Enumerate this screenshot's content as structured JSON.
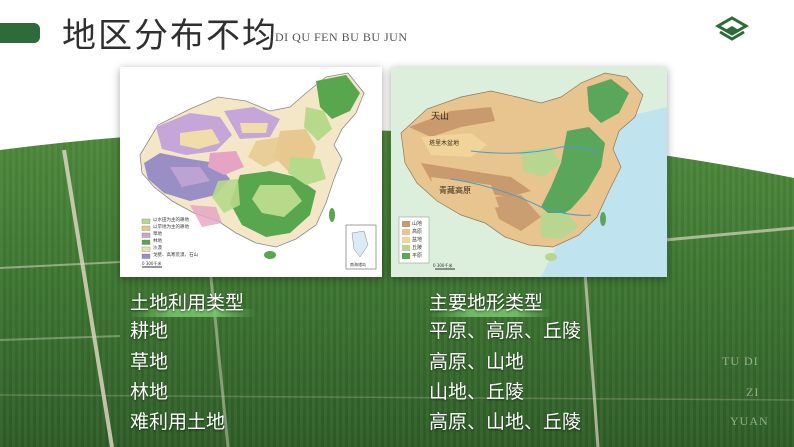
{
  "slide": {
    "title": "地区分布不均",
    "title_pinyin": "DI QU FEN BU BU JUN",
    "logo_icon": "layered-diamond-logo-icon",
    "colors": {
      "accent_green": "#2e6a3a",
      "field_dark": "#2c5a25",
      "field_light": "#4f8a3c",
      "text_dark": "#2f2f2f",
      "highlight": "#7cc86e"
    }
  },
  "map_left": {
    "legend": [
      {
        "label": "以水田为主的耕地",
        "color": "#b6d98a"
      },
      {
        "label": "以旱地为主的耕地",
        "color": "#e7c98f"
      },
      {
        "label": "草地",
        "color": "#c6a6d8"
      },
      {
        "label": "林地",
        "color": "#58a64e"
      },
      {
        "label": "沙漠",
        "color": "#f1dda9"
      },
      {
        "label": "戈壁、高寒荒漠、石山",
        "color": "#9a8fc4"
      }
    ],
    "scale": "0    300千米",
    "inset_label": "南海诸岛"
  },
  "map_right": {
    "place_labels": {
      "tianshan": "天山",
      "basin": "塔里木盆地",
      "plateau": "青藏高原"
    },
    "legend": [
      {
        "label": "山地",
        "color": "#c89a6e"
      },
      {
        "label": "高原",
        "color": "#e8c48e"
      },
      {
        "label": "盆地",
        "color": "#f0d49a"
      },
      {
        "label": "丘陵",
        "color": "#b8d690"
      },
      {
        "label": "平原",
        "color": "#5aa65a"
      }
    ],
    "scale": "0  300千米"
  },
  "table": {
    "headers": [
      "土地利用类型",
      "主要地形类型"
    ],
    "rows": [
      {
        "land": "耕地",
        "terrain": "平原、高原、丘陵"
      },
      {
        "land": "草地",
        "terrain": "高原、山地"
      },
      {
        "land": "林地",
        "terrain": "山地、丘陵"
      },
      {
        "land": "难利用土地",
        "terrain": "高原、山地、丘陵"
      }
    ]
  },
  "side_pinyin": [
    "TU DI",
    "ZI",
    "YUAN"
  ]
}
